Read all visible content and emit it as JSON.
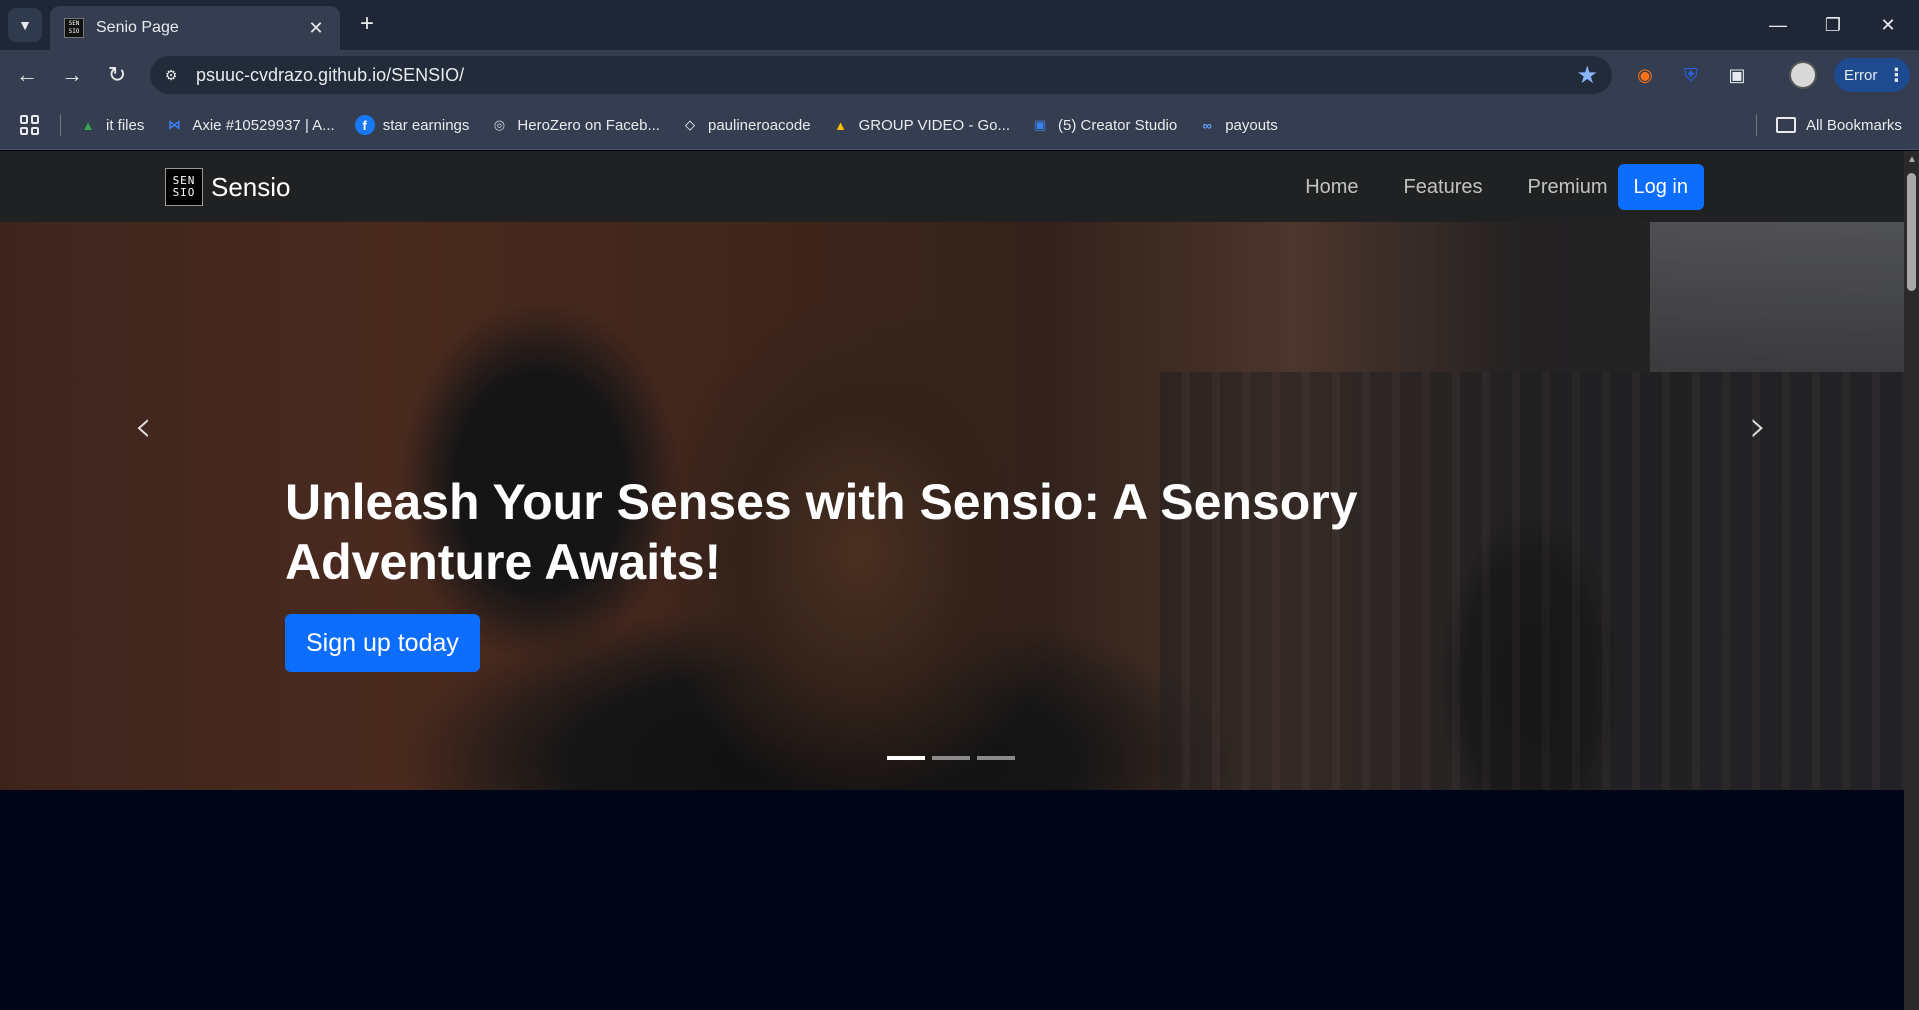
{
  "browser": {
    "tab_title": "Senio Page",
    "tab_favicon_text": "SEN SIO",
    "url": "psuuc-cvdrazo.github.io/SENSIO/",
    "profile_status": "Error",
    "bookmarks": [
      {
        "label": "it files",
        "icon": "google-drive-icon",
        "color": "#34a853"
      },
      {
        "label": "Axie #10529937 | A...",
        "icon": "axie-icon",
        "color": "#3b82f6"
      },
      {
        "label": "star earnings",
        "icon": "facebook-icon",
        "color": "#1877f2"
      },
      {
        "label": "HeroZero on Faceb...",
        "icon": "globe-icon",
        "color": "#cbd5e1"
      },
      {
        "label": "paulineroacode",
        "icon": "code-icon",
        "color": "#ffffff"
      },
      {
        "label": "GROUP VIDEO - Go...",
        "icon": "google-drive-icon",
        "color": "#fbbc04"
      },
      {
        "label": "(5) Creator Studio",
        "icon": "creator-studio-icon",
        "color": "#3b82f6"
      },
      {
        "label": "payouts",
        "icon": "meta-icon",
        "color": "#60a5fa"
      }
    ],
    "all_bookmarks": "All Bookmarks"
  },
  "site": {
    "brand": "Sensio",
    "logo_text": "SEN SIO",
    "nav": [
      "Home",
      "Features",
      "Premium"
    ],
    "login": "Log in",
    "hero": {
      "title": "Unleash Your Senses with Sensio: A Sensory Adventure Awaits!",
      "cta": "Sign up today",
      "slides": 3,
      "active_slide": 1
    }
  },
  "colors": {
    "primary": "#0d6efd",
    "navbar": "#1f2123",
    "page_bg": "#020617"
  }
}
